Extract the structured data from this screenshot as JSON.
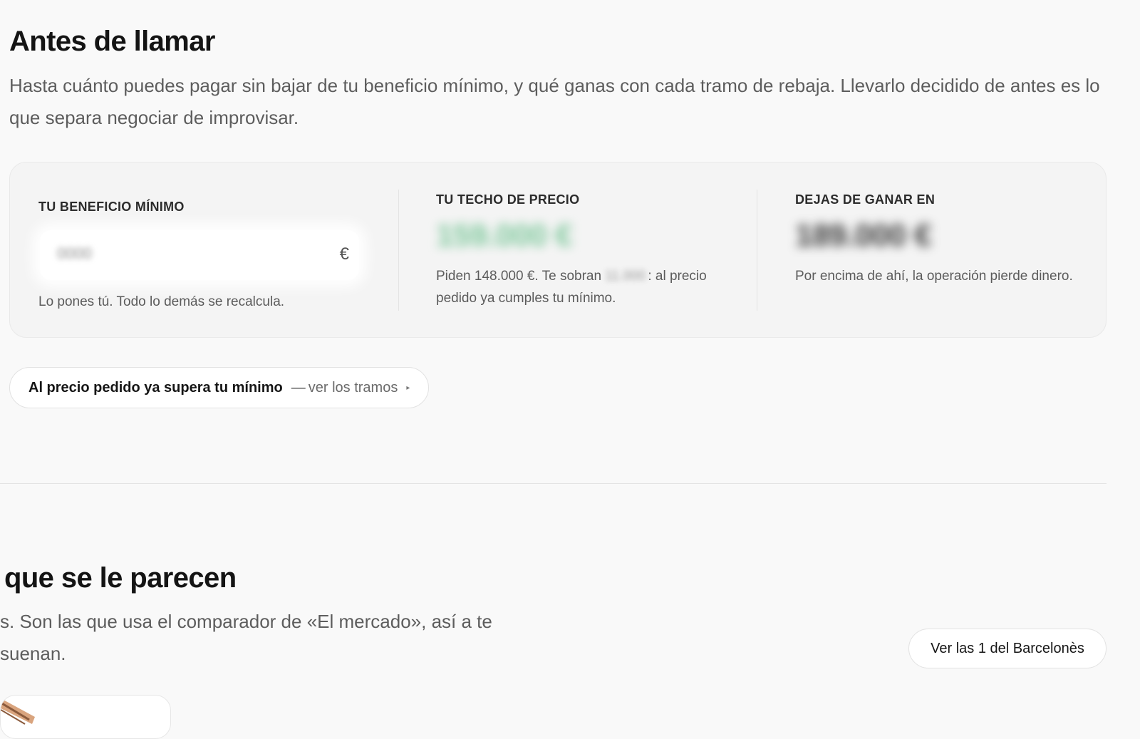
{
  "section": {
    "title": "Antes de llamar",
    "lead": "Hasta cuánto puedes pagar sin bajar de tu beneficio mínimo, y qué ganas con cada tramo de rebaja. Llevarlo decidido de antes es lo que separa negociar de improvisar."
  },
  "card": {
    "min_benefit": {
      "label": "TU BENEFICIO MÍNIMO",
      "input_value": "0000",
      "unit": "€",
      "note": "Lo pones tú. Todo lo demás se recalcula."
    },
    "price_ceiling": {
      "label": "TU TECHO DE PRECIO",
      "value": "159.000 €",
      "value_color": "#7cc79a",
      "note_prefix": "Piden 148.000 €. Te sobran ",
      "note_surplus": "11.000",
      "note_suffix": ": al precio pedido ya cumples tu mínimo."
    },
    "stop_earning": {
      "label": "DEJAS DE GANAR EN",
      "value": "189.000 €",
      "value_color": "#3a3a3a",
      "note": "Por encima de ahí, la operación pierde dinero."
    }
  },
  "tramos": {
    "strong": "Al precio pedido ya supera tu mínimo",
    "separator": "—",
    "link": "ver los tramos",
    "chevron": "▸"
  },
  "section2": {
    "title": "que se le parecen",
    "lead": "s. Son las que usa el comparador de «El mercado», así a te suenan.",
    "barcelones_button": "Ver las 1 del Barcelonès"
  }
}
